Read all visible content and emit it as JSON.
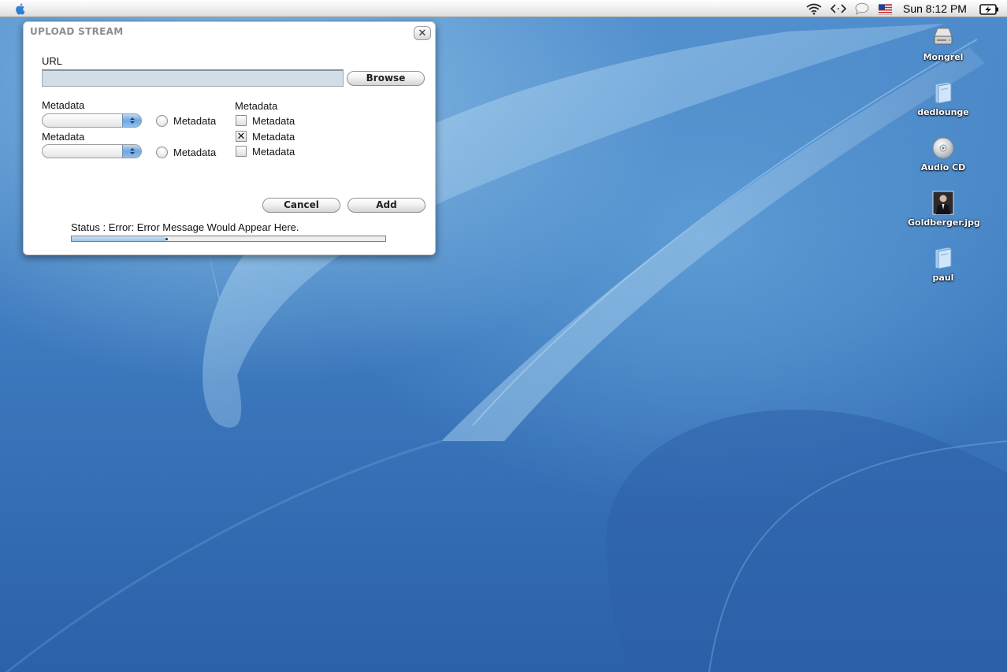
{
  "menubar": {
    "clock": "Sun 8:12 PM",
    "icons": [
      "wifi-icon",
      "script-icon",
      "chat-bubble-icon",
      "us-flag-icon",
      "battery-icon"
    ]
  },
  "dialog": {
    "title": "UPLOAD STREAM",
    "close_label": "✕",
    "url_label": "URL",
    "url_value": "",
    "browse_label": "Browse",
    "select_group": [
      {
        "label": "Metadata",
        "value": "",
        "radio_label": "Metadata",
        "radio_checked": false
      },
      {
        "label": "Metadata",
        "value": "",
        "radio_label": "Metadata",
        "radio_checked": false
      }
    ],
    "checkbox_group": {
      "label": "Metadata",
      "items": [
        {
          "label": "Metadata",
          "checked": false
        },
        {
          "label": "Metadata",
          "checked": true
        },
        {
          "label": "Metadata",
          "checked": false
        }
      ]
    },
    "cancel_label": "Cancel",
    "add_label": "Add",
    "status_text": "Status : Error: Error Message Would Appear Here.",
    "progress": 0.3
  },
  "desktop_icons": [
    {
      "label": "Mongrel",
      "icon": "hard-drive-icon"
    },
    {
      "label": "dedlounge",
      "icon": "folder-icon"
    },
    {
      "label": "Audio CD",
      "icon": "cd-icon"
    },
    {
      "label": "Goldberger.jpg",
      "icon": "photo-icon"
    },
    {
      "label": "paul",
      "icon": "folder-icon"
    }
  ],
  "colors": {
    "desktop_blue": "#3f7cc0",
    "select_arrow_blue": "#6fa6de",
    "title_gray": "#8d8d8d"
  }
}
